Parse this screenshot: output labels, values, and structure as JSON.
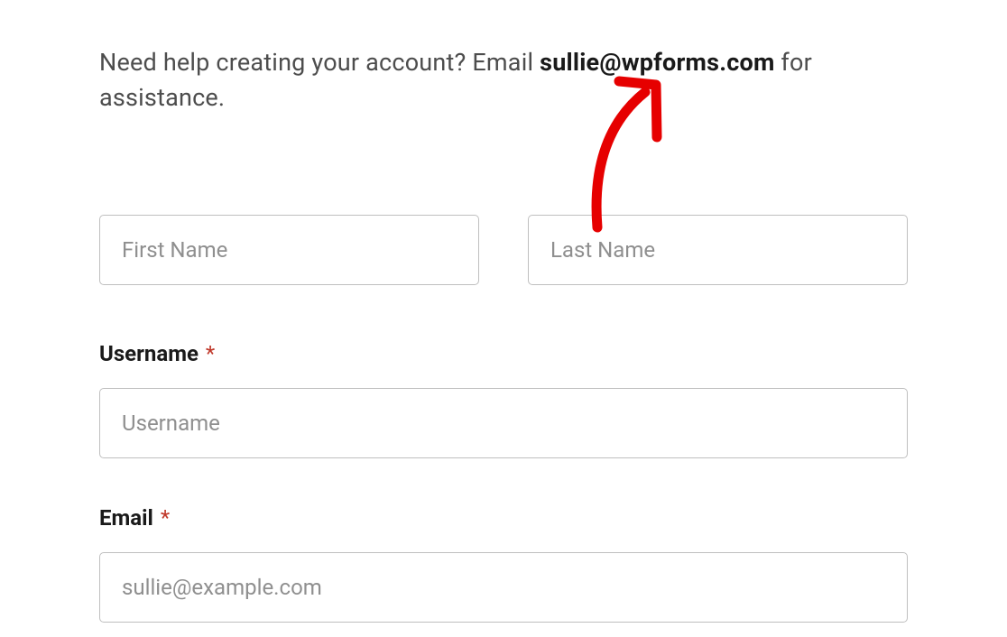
{
  "help": {
    "prefix": "Need help creating your account? Email ",
    "email": "sullie@wpforms.com",
    "suffix": " for assistance."
  },
  "fields": {
    "first_name": {
      "placeholder": "First Name"
    },
    "last_name": {
      "placeholder": "Last Name"
    },
    "username": {
      "label": "Username",
      "placeholder": "Username",
      "required": "*"
    },
    "email": {
      "label": "Email",
      "placeholder": "sullie@example.com",
      "required": "*"
    }
  },
  "annotation": {
    "arrow_color": "#e60000"
  }
}
